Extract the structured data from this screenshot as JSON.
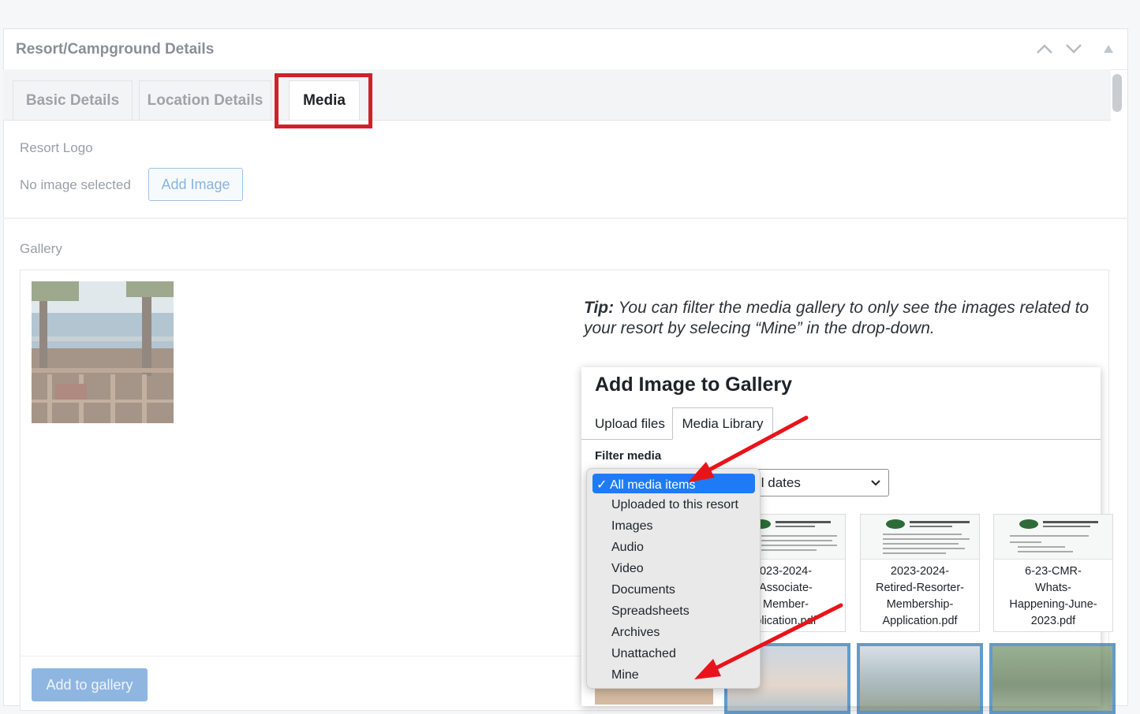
{
  "panel": {
    "title": "Resort/Campground Details",
    "controls": {
      "up": "^",
      "down": "v",
      "toggle": "▲"
    }
  },
  "tabs": [
    {
      "label": "Basic Details",
      "active": false
    },
    {
      "label": "Location Details",
      "active": false
    },
    {
      "label": "Media",
      "active": true
    }
  ],
  "resort_logo": {
    "label": "Resort Logo",
    "status": "No image selected",
    "button": "Add Image"
  },
  "gallery": {
    "label": "Gallery",
    "add_button": "Add to gallery"
  },
  "tip": {
    "lead": "Tip:",
    "text": "You can filter the media gallery to only see the images related to your resort by selecing “Mine” in the drop-down."
  },
  "modal": {
    "title": "Add Image to Gallery",
    "tabs": [
      "Upload files",
      "Media Library"
    ],
    "filter_label": "Filter media",
    "date_filter": "ll dates",
    "dropdown": {
      "selected": "All media items",
      "options": [
        "Uploaded to this resort",
        "Images",
        "Audio",
        "Video",
        "Documents",
        "Spreadsheets",
        "Archives",
        "Unattached",
        "Mine"
      ]
    },
    "documents": [
      {
        "name": "023-2024-Associate-Member-plication.pdf",
        "lines": [
          "023-2024-",
          "Associate-",
          "Member-",
          "plication.pdf"
        ]
      },
      {
        "name": "2023-2024-Retired-Resorter-Membership-Application.pdf",
        "lines": [
          "2023-2024-",
          "Retired-Resorter-",
          "Membership-",
          "Application.pdf"
        ]
      },
      {
        "name": "6-23-CMR-Whats-Happening-June-2023.pdf",
        "lines": [
          "6-23-CMR-",
          "Whats-",
          "Happening-June-",
          "2023.pdf"
        ]
      }
    ]
  },
  "colors": {
    "highlight": "#d0202c",
    "annotation_arrow": "#e8141b",
    "dropdown_selected": "#1f7bf5",
    "primary_button": "#8fb6e0"
  }
}
